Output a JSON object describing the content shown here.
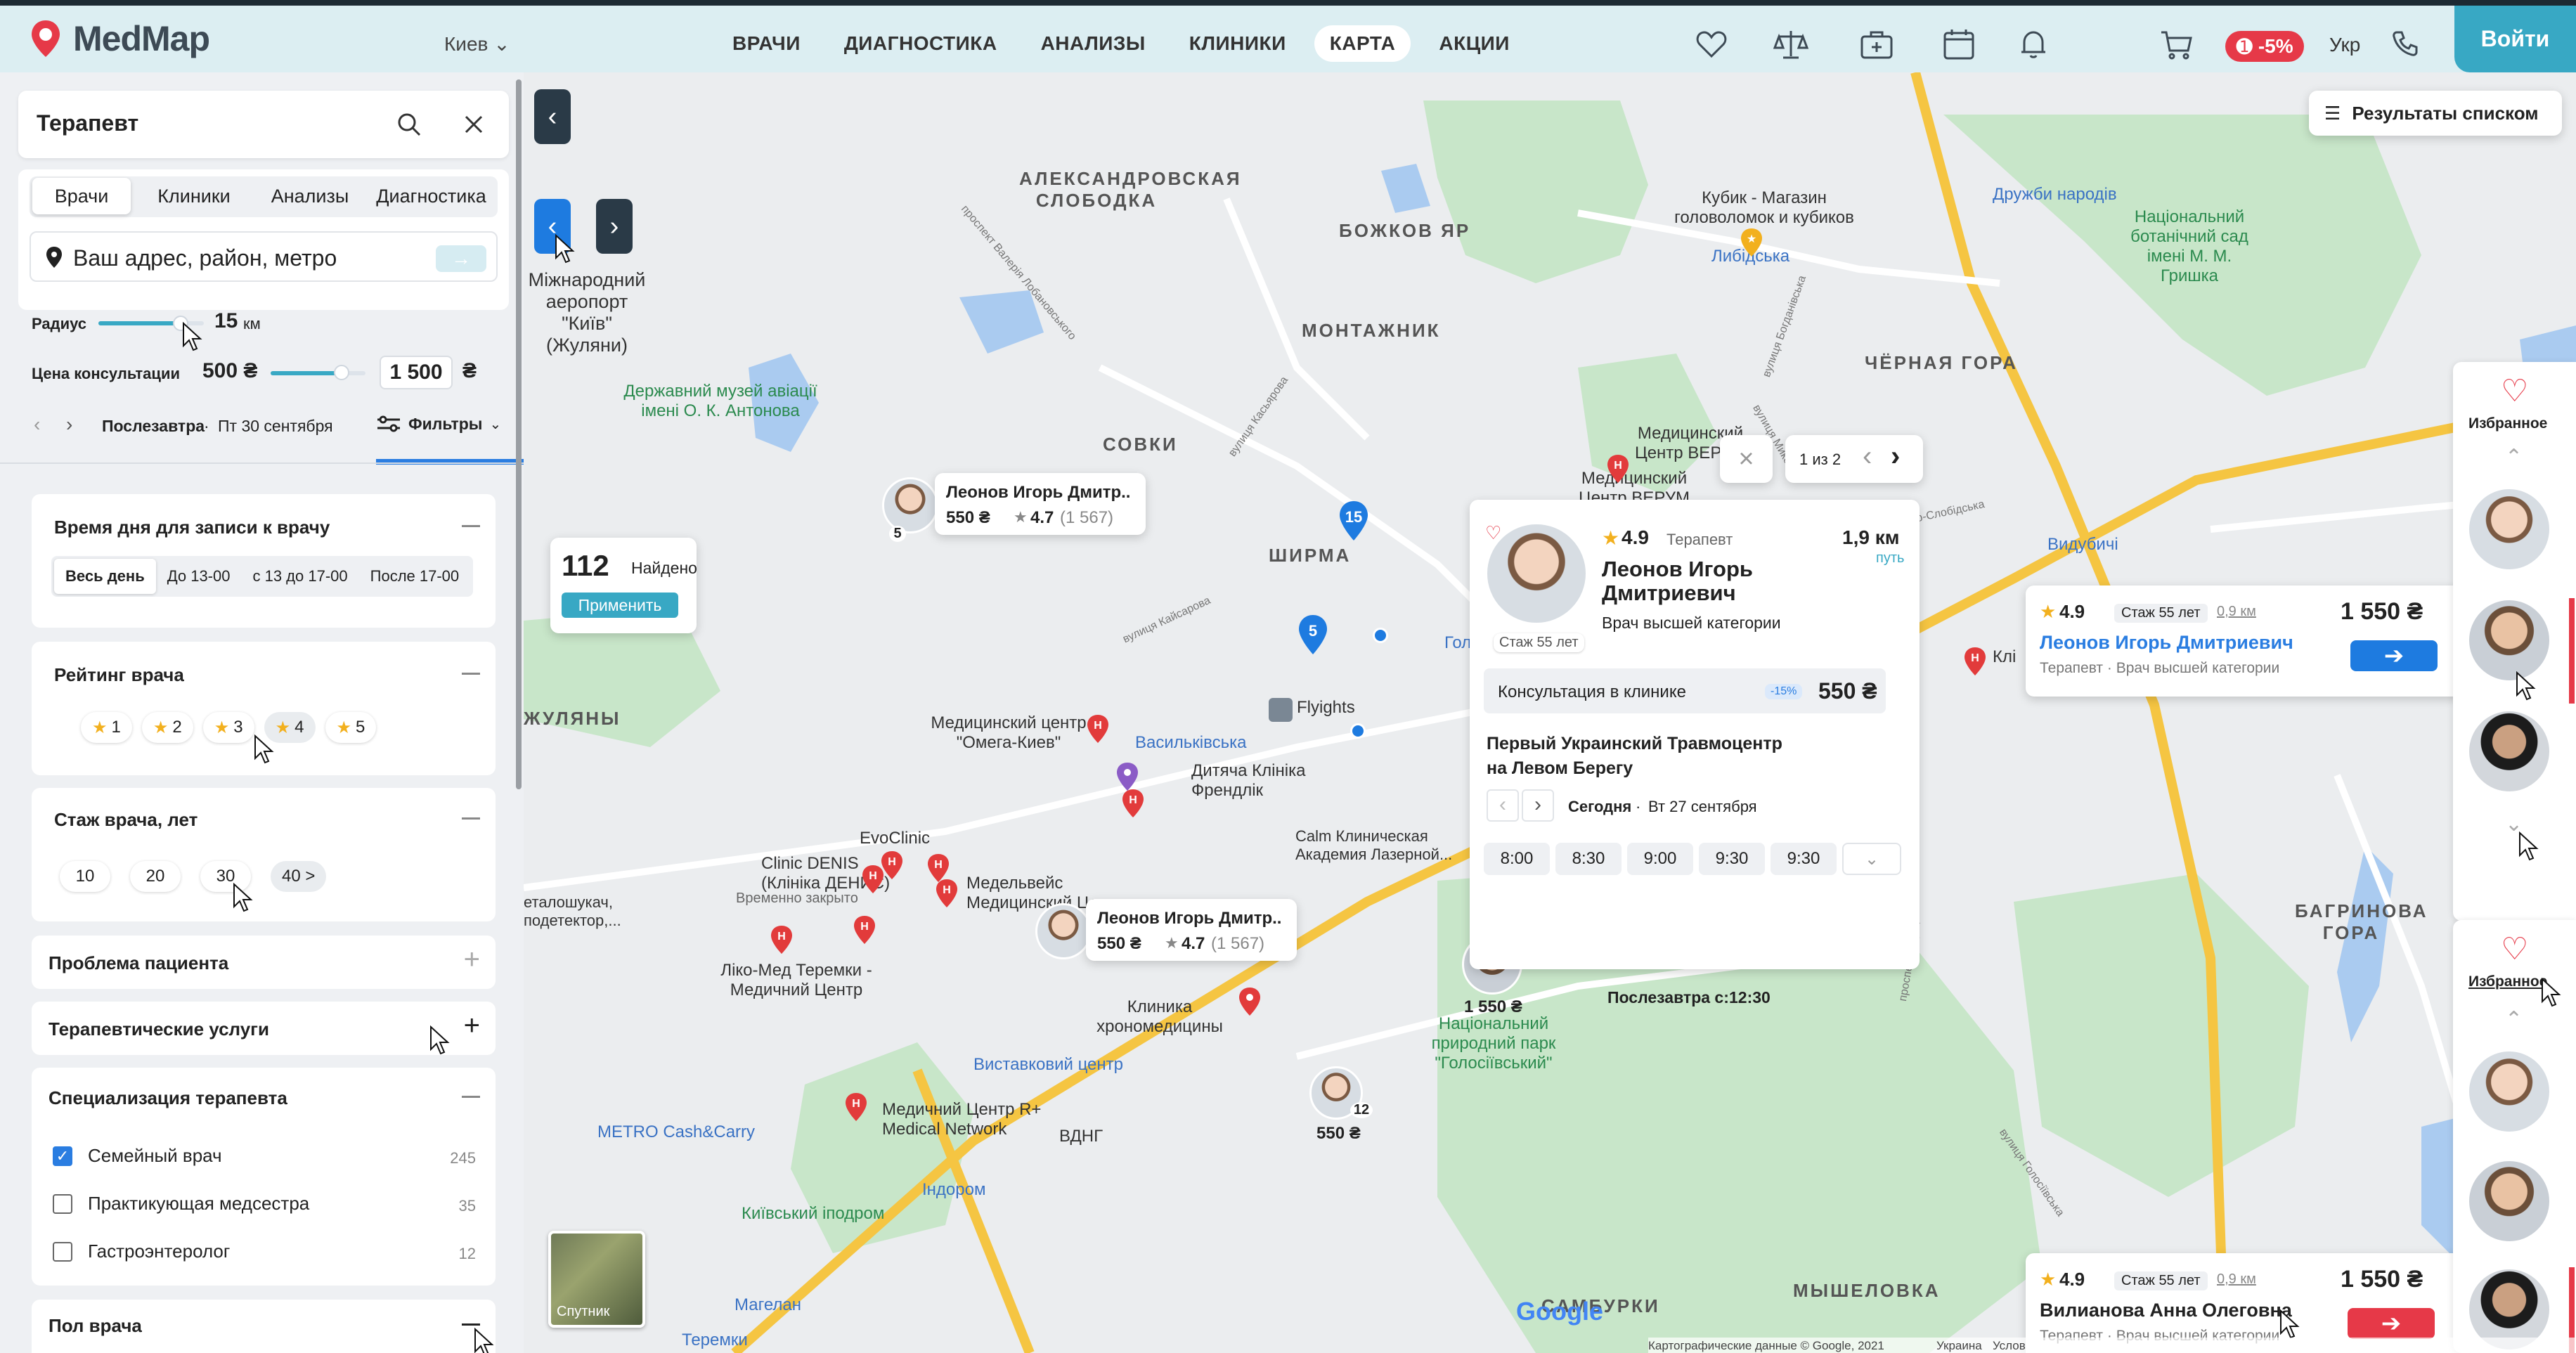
{
  "header": {
    "logo": "MedMap",
    "city": "Киев",
    "nav": [
      "ВРАЧИ",
      "ДИАГНОСТИКА",
      "АНАЛИЗЫ",
      "КЛИНИКИ",
      "КАРТА",
      "АКЦИИ"
    ],
    "active_nav": "КАРТА",
    "promo": "-5%",
    "lang": "Укр",
    "login": "Войти",
    "icons": [
      "heart-icon",
      "scales-icon",
      "medkit-icon",
      "calendar-icon",
      "bell-icon",
      "cart-icon",
      "phone-icon"
    ]
  },
  "sidebar": {
    "search": {
      "value": "Терапевт"
    },
    "tabs": [
      "Врачи",
      "Клиники",
      "Анализы",
      "Диагностика"
    ],
    "address_placeholder": "Ваш адрес, район, метро",
    "radius": {
      "label": "Радиус",
      "value": "15",
      "unit": "км"
    },
    "price": {
      "label": "Цена консультации",
      "min": "500 ₴",
      "max": "1 500",
      "currency": "₴"
    },
    "date": {
      "day": "Послезавтра",
      "date": "Пт 30 сентября",
      "filters": "Фильтры"
    },
    "time_card": {
      "title": "Время дня для записи к врачу",
      "options": [
        "Весь день",
        "До 13-00",
        "с 13 до 17-00",
        "После 17-00"
      ],
      "selected": "Весь день"
    },
    "rating_card": {
      "title": "Рейтинг врача",
      "options": [
        "1",
        "2",
        "3",
        "4",
        "5"
      ],
      "selected": "4"
    },
    "experience_card": {
      "title": "Стаж врача, лет",
      "options": [
        "10",
        "20",
        "30",
        "40 >"
      ],
      "selected": "40 >"
    },
    "problem": "Проблема пациента",
    "services": "Терапевтические услуги",
    "specialization": {
      "title": "Специализация терапевта",
      "items": [
        {
          "label": "Семейный врач",
          "count": "245",
          "checked": true
        },
        {
          "label": "Практикующая медсестра",
          "count": "35",
          "checked": false
        },
        {
          "label": "Гастроэнтеролог",
          "count": "12",
          "checked": false
        }
      ]
    },
    "gender": "Пол врача"
  },
  "map": {
    "found": {
      "count": "112",
      "label": "Найдено",
      "apply": "Применить"
    },
    "results_list": "Результаты списком",
    "labels": {
      "aleksandrovska": "АЛЕКСАНДРОВСКАЯ СЛОБОДКА",
      "bozhkov": "БОЖКОВ ЯР",
      "montazhnik": "МОНТАЖНИК",
      "chorna_gora": "ЧЁРНАЯ ГОРА",
      "sovki": "СОВКИ",
      "shirma": "ШИРМА",
      "zhuliany": "ЖУЛЯНЫ",
      "bagrinova": "БАГРИНОВА ГОРА",
      "myshelovka": "МЫШЕЛОВКА",
      "samburki": "САМБУРКИ",
      "airport": "Міжнародний аеропорт \"Київ\" (Жуляни)",
      "museum": "Державний музей авіації імені О. К. Антонова",
      "kubik": "Кубик - Магазин головоломок и кубиков",
      "libidska": "Либідська",
      "druzhby": "Дружби народів",
      "botanic": "Національний ботанічний сад імені М. М. Гришка",
      "verum": "Медицинский Центр ВЕРУМ",
      "omega": "Медицинский центр \"Омега-Киев\"",
      "vasylkivska": "Васильківська",
      "flyights": "Flyights",
      "dytiacha": "Дитяча Клініка Френдлік",
      "evoclinic": "EvoClinic",
      "clinic_denis": "Clinic DENIS (Клініка ДЕНИС)",
      "closed": "Временно закрыто",
      "medelvein": "Медельвейс Медицинский Центр",
      "liko": "Ліко-Мед Теремки - Медичний Центр",
      "klinika_hrono": "Клиника хрономедицины",
      "vystavkovyi": "Виставковий центр",
      "rplus": "Медичний Центр R+ Medical Network",
      "metro_cash": "METRO Cash&Carry",
      "vdng": "ВДНГ",
      "indorom": "Індором",
      "kyiv_ipodrom": "Київський іподром",
      "magelan": "Магелан",
      "holosiivskyi": "Національний природний парк \"Голосіївський\"",
      "teremky": "Теремки",
      "satellite": "Спутник",
      "attribution": "Картографические данные © Google, 2021",
      "ukraine": "Украина",
      "conditions": "Услов",
      "metal": "еталошукач, подетектор,...",
      "calm": "Calm Клиническая Академия Лазерной...",
      "kli": "Клі",
      "vydubychi": "Видубичі",
      "holo": "Голо",
      "after_tomorrow": "Послезавтра с:",
      "after_time": "12:30",
      "street_lob": "проспект Валерія Лобановського",
      "street_kasyarova": "вулиця Касьярова",
      "street_saperno": "вулиця Саперно-Слобідська",
      "street_nauky": "проспект Науки",
      "street_mykola": "вулиця Миколи",
      "street_bogdanivska": "вулиця Богданівська",
      "street_holosiivska": "вулиця Голосіївська",
      "street_kaisarova": "вулиця Кайсарова"
    },
    "mini_cards": [
      {
        "name": "Леонов Игорь Дмитр..",
        "price": "550 ₴",
        "rating": "4.7",
        "reviews": "(1 567)",
        "badge": "5"
      },
      {
        "name": "Леонов Игорь Дмитр..",
        "price": "550 ₴",
        "rating": "4.7",
        "reviews": "(1 567)"
      }
    ],
    "map_pins": [
      {
        "price": "1 550 ₴"
      },
      {
        "price": "550 ₴",
        "badge": "12"
      }
    ],
    "clusters": [
      "15",
      "5"
    ],
    "popup": {
      "pager": "1 из 2",
      "rating": "4.9",
      "role": "Терапевт",
      "distance": "1,9 км",
      "route": "путь",
      "name": "Леонов Игорь Дмитриевич",
      "category": "Врач высшей категории",
      "experience": "Стаж 55 лет",
      "consult_label": "Консультация в клинике",
      "discount": "-15%",
      "consult_price": "550 ₴",
      "clinic": "Первый Украинский Травмоцентр на Левом Берегу",
      "day": "Сегодня",
      "date": "Вт 27 сентября",
      "times": [
        "8:00",
        "8:30",
        "9:00",
        "9:30",
        "9:30"
      ]
    },
    "right_cards": [
      {
        "rating": "4.9",
        "experience": "Стаж 55 лет",
        "distance": "0,9 км",
        "price": "1 550 ₴",
        "name": "Леонов Игорь Дмитриевич",
        "meta": "Терапевт · Врач высшей категории",
        "accent": "#2a7de1"
      },
      {
        "rating": "4.9",
        "experience": "Стаж 55 лет",
        "distance": "0,9 км",
        "price": "1 550 ₴",
        "name": "Вилианова Анна Олеговна",
        "meta": "Терапевт · Врач высшей категории",
        "accent": "#e63948"
      }
    ],
    "favorites_label": "Избранное"
  }
}
